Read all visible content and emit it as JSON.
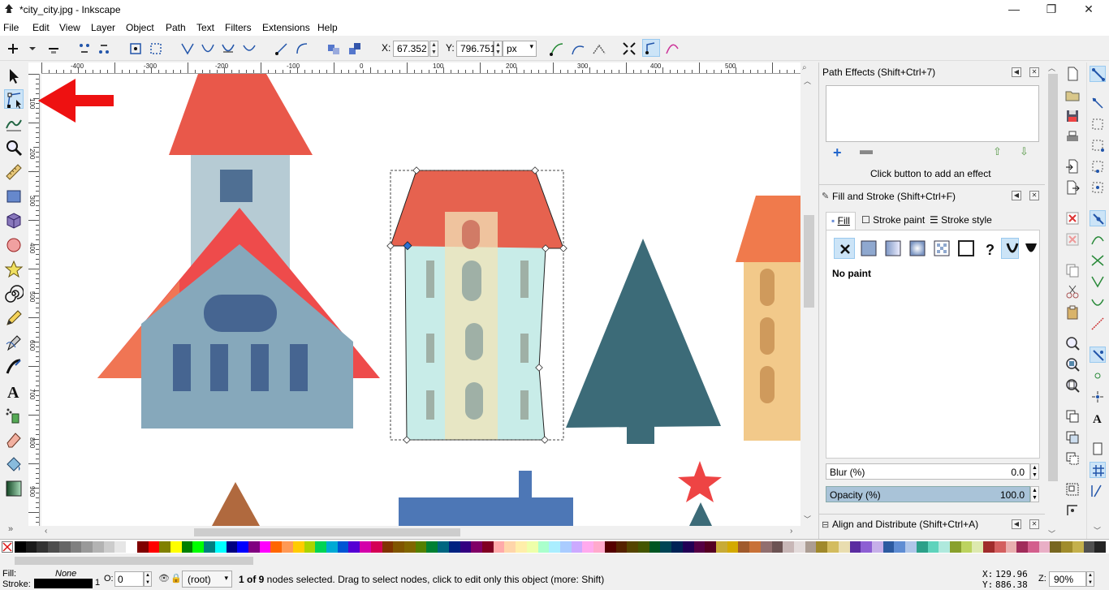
{
  "window": {
    "title": "*city_city.jpg - Inkscape",
    "controls": [
      "—",
      "❐",
      "✕"
    ]
  },
  "menu": [
    "File",
    "Edit",
    "View",
    "Layer",
    "Object",
    "Path",
    "Text",
    "Filters",
    "Extensions",
    "Help"
  ],
  "toolbar": {
    "x_label": "X:",
    "x_value": "67.352",
    "y_label": "Y:",
    "y_value": "796.751",
    "unit": "px"
  },
  "ruler": {
    "h_labels": [
      "-400",
      "-300",
      "-200",
      "-100",
      "0",
      "100",
      "200",
      "300",
      "400",
      "500"
    ],
    "v_labels": [
      "100",
      "200",
      "300",
      "400",
      "500",
      "600",
      "700",
      "800",
      "900"
    ]
  },
  "path_effects": {
    "title": "Path Effects  (Shift+Ctrl+7)",
    "hint": "Click button to add an effect"
  },
  "fill_stroke": {
    "title": "Fill and Stroke (Shift+Ctrl+F)",
    "tabs": [
      "Fill",
      "Stroke paint",
      "Stroke style"
    ],
    "paint_label": "No paint",
    "blur_label": "Blur (%)",
    "blur_value": "0.0",
    "opacity_label": "Opacity (%)",
    "opacity_value": "100.0"
  },
  "align": {
    "title": "Align and Distribute (Shift+Ctrl+A)"
  },
  "palette": [
    "#000000",
    "#1a1a1a",
    "#333333",
    "#4d4d4d",
    "#666666",
    "#808080",
    "#999999",
    "#b3b3b3",
    "#cccccc",
    "#e6e6e6",
    "#ffffff",
    "#800000",
    "#ff0000",
    "#808000",
    "#ffff00",
    "#008000",
    "#00ff00",
    "#008080",
    "#00ffff",
    "#000080",
    "#0000ff",
    "#800080",
    "#ff00ff",
    "#ff6600",
    "#ff9955",
    "#ffcc00",
    "#aad400",
    "#00d455",
    "#00aad4",
    "#0055d4",
    "#5500d4",
    "#d400aa",
    "#d40055",
    "#803300",
    "#805500",
    "#806600",
    "#558000",
    "#008033",
    "#006680",
    "#002280",
    "#330080",
    "#800066",
    "#800022",
    "#ffaaaa",
    "#ffd5aa",
    "#ffeeaa",
    "#eeffaa",
    "#aaffcc",
    "#aaeeff",
    "#aaccff",
    "#ccaaff",
    "#ffaaee",
    "#ffaacc",
    "#550000",
    "#552200",
    "#554400",
    "#445500",
    "#005522",
    "#004455",
    "#002255",
    "#220055",
    "#550044",
    "#550022",
    "#c8ab37",
    "#d4aa00",
    "#a05a2c",
    "#c87137",
    "#916f6f",
    "#6c5353",
    "#c8b7b7",
    "#e3dbdb",
    "#ac9d93",
    "#a0892c",
    "#d3bc5f",
    "#e9ddaf",
    "#5a2ca0",
    "#8d5fd3",
    "#c6afe9",
    "#2c5aa0",
    "#5f8dd3",
    "#afc6e9",
    "#2ca089",
    "#5fd3bc",
    "#afe9dd",
    "#89a02c",
    "#bcd35f",
    "#dde9af",
    "#a02c2c",
    "#d35f5f",
    "#e9afaf",
    "#a02c5a",
    "#d35f8d",
    "#e9afc6",
    "#786721",
    "#a08c2c",
    "#c4b04c",
    "#505050",
    "#252525"
  ],
  "status": {
    "fill_label": "Fill:",
    "fill_value": "None",
    "stroke_label": "Stroke:",
    "stroke_width": "1",
    "opacity_label": "O:",
    "opacity_value": "0",
    "layer": "(root)",
    "message_bold": "1 of 9",
    "message_rest": " nodes selected. Drag to select nodes, click to edit only this object (more: Shift)",
    "cx_label": "X:",
    "cx_value": "129.96",
    "cy_label": "Y:",
    "cy_value": "886.38",
    "zoom_label": "Z:",
    "zoom_value": "90%"
  }
}
